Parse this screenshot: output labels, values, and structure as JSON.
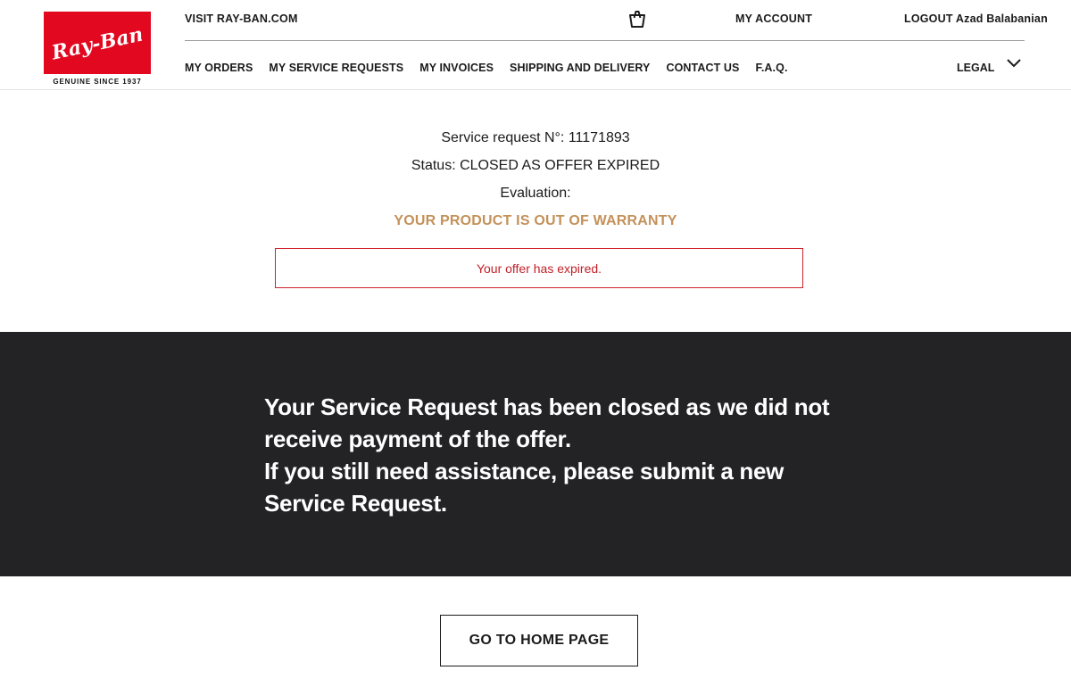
{
  "brand": {
    "logo_text": "Ray-Ban",
    "tagline": "GENUINE SINCE 1937",
    "color": "#e1081f"
  },
  "header": {
    "visit_link": "VISIT RAY-BAN.COM",
    "cart_icon": "shopping-bag-icon",
    "my_account": "MY ACCOUNT",
    "logout_label": "LOGOUT",
    "user_name": "Azad Balabanian",
    "nav": [
      {
        "label": "MY ORDERS"
      },
      {
        "label": "MY SERVICE REQUESTS"
      },
      {
        "label": "MY INVOICES"
      },
      {
        "label": "SHIPPING AND DELIVERY"
      },
      {
        "label": "CONTACT US"
      },
      {
        "label": "F.A.Q."
      }
    ],
    "legal": "LEGAL",
    "legal_icon": "chevron-down-icon"
  },
  "request": {
    "number_label": "Service request N°:",
    "number": "11171893",
    "status_label": "Status:",
    "status": "CLOSED AS OFFER EXPIRED",
    "evaluation_label": "Evaluation:",
    "evaluation": "YOUR PRODUCT IS OUT OF WARRANTY",
    "evaluation_color": "#c4915a",
    "alert": "Your offer has expired.",
    "alert_color": "#c22028"
  },
  "notice": {
    "line1": "Your Service Request has been closed as we did not receive payment of the offer.",
    "line2": "If you still need assistance, please submit a new Service Request.",
    "background": "#232326"
  },
  "actions": {
    "home_button": "GO TO HOME PAGE"
  }
}
